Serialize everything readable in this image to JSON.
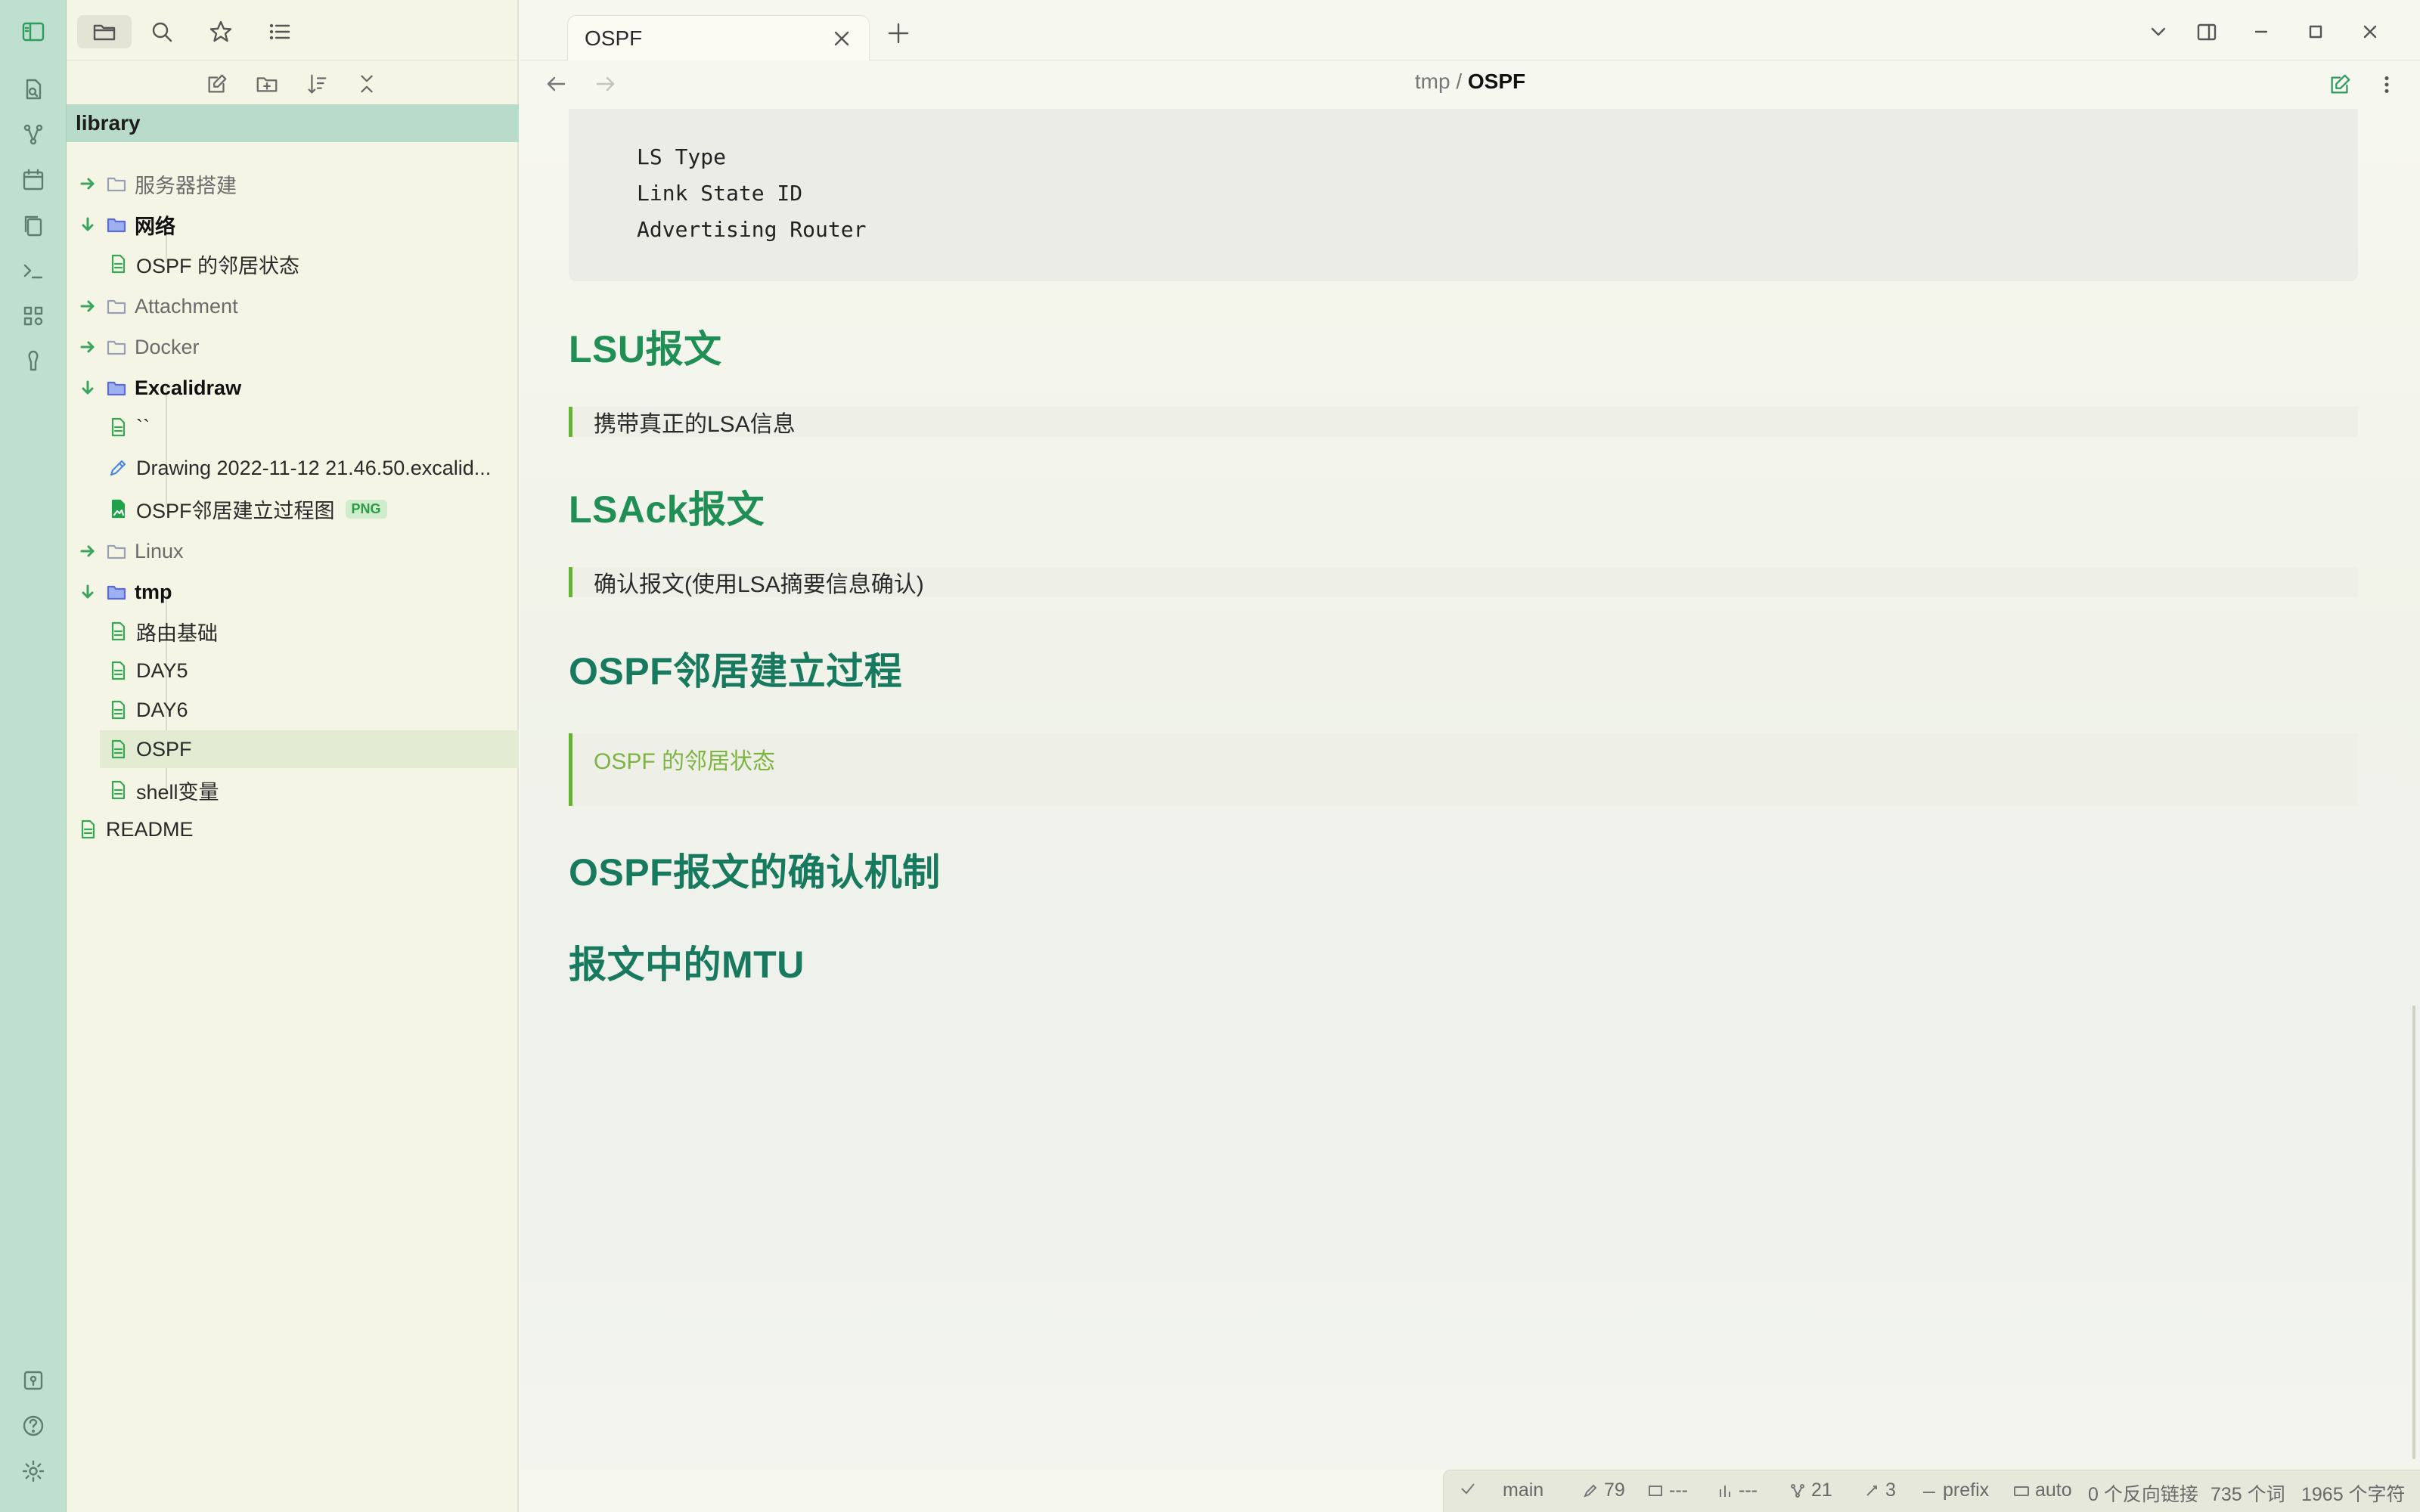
{
  "sidebar": {
    "vault_title": "library",
    "tree": [
      {
        "type": "folder",
        "label": "服务器搭建",
        "open": false,
        "depth": 0
      },
      {
        "type": "folder",
        "label": "网络",
        "open": true,
        "depth": 0
      },
      {
        "type": "file",
        "label": "OSPF 的邻居状态",
        "depth": 1
      },
      {
        "type": "folder",
        "label": "Attachment",
        "open": false,
        "depth": 0
      },
      {
        "type": "folder",
        "label": "Docker",
        "open": false,
        "depth": 0
      },
      {
        "type": "folder",
        "label": "Excalidraw",
        "open": true,
        "depth": 0
      },
      {
        "type": "file",
        "label": "``",
        "depth": 1
      },
      {
        "type": "drawing",
        "label": "Drawing 2022-11-12 21.46.50.excalid...",
        "depth": 1
      },
      {
        "type": "image",
        "label": "OSPF邻居建立过程图",
        "badge": "PNG",
        "depth": 1
      },
      {
        "type": "folder",
        "label": "Linux",
        "open": false,
        "depth": 0
      },
      {
        "type": "folder",
        "label": "tmp",
        "open": true,
        "depth": 0
      },
      {
        "type": "file",
        "label": "路由基础",
        "depth": 1
      },
      {
        "type": "file",
        "label": "DAY5",
        "depth": 1
      },
      {
        "type": "file",
        "label": "DAY6",
        "depth": 1
      },
      {
        "type": "file",
        "label": "OSPF",
        "depth": 1,
        "selected": true
      },
      {
        "type": "file",
        "label": "shell变量",
        "depth": 1
      },
      {
        "type": "file",
        "label": "README",
        "depth": 0
      }
    ]
  },
  "tab": {
    "title": "OSPF"
  },
  "breadcrumb": {
    "folder": "tmp",
    "sep": "/",
    "file": "OSPF"
  },
  "content": {
    "code_lines": [
      "LS Type",
      "Link State ID",
      "Advertising Router"
    ],
    "h_lsu": "LSU报文",
    "q_lsu": "携带真正的LSA信息",
    "h_lsack": "LSAck报文",
    "q_lsack": "确认报文(使用LSA摘要信息确认)",
    "h_neighbor": "OSPF邻居建立过程",
    "q_neighbor_link": "OSPF 的邻居状态",
    "h_ack": "OSPF报文的确认机制",
    "h_mtu": "报文中的MTU"
  },
  "status": {
    "branch": "main",
    "edits": "79",
    "s2": "---",
    "s3": "---",
    "nodes": "21",
    "links": "3",
    "prefix": "prefix",
    "mode": "auto",
    "backlinks": "0 个反向链接",
    "words": "735 个词",
    "chars": "1965 个字符"
  },
  "colors": {
    "accent": "#2e9b5f",
    "heading": "#1f8f55",
    "ribbon": "#bfe0cf",
    "vault_bar": "#b8dcc9"
  }
}
